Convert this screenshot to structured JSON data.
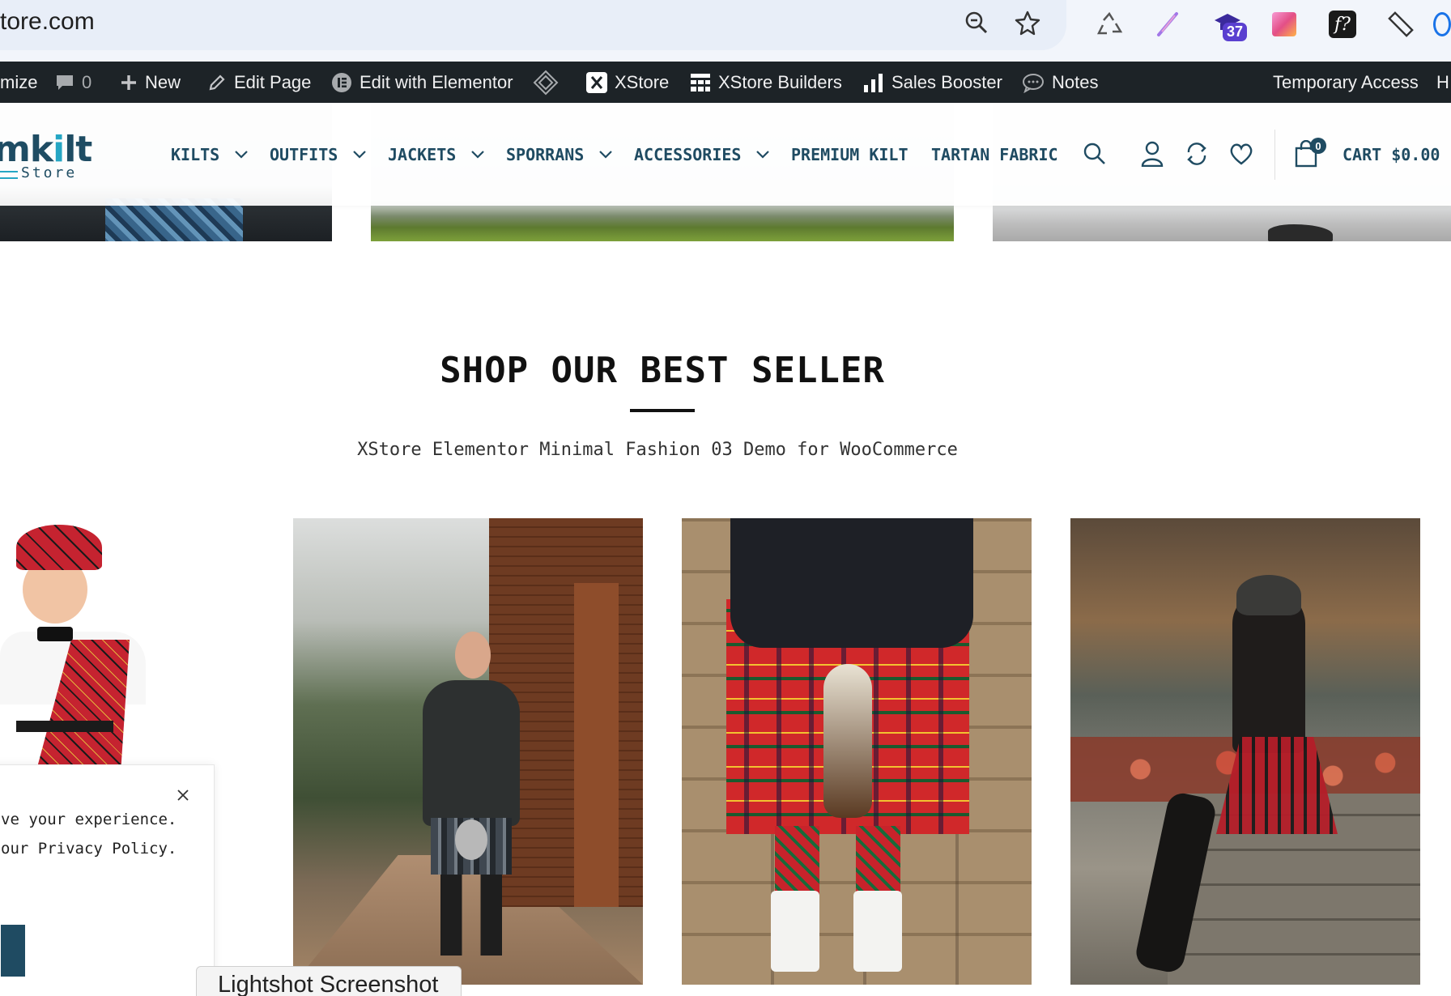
{
  "browser": {
    "url": "tore.com",
    "extension_badge": "37",
    "icons": [
      "zoom-icon",
      "star-icon",
      "recycle-icon",
      "feather-icon",
      "graduation-cap-icon",
      "gradient-square-icon",
      "font-question-icon",
      "ruler-icon"
    ]
  },
  "admin_bar": {
    "customize": "mize",
    "comments_count": "0",
    "new": "New",
    "edit_page": "Edit Page",
    "edit_elementor": "Edit with Elementor",
    "xstore": "XStore",
    "xstore_builders": "XStore Builders",
    "sales_booster": "Sales Booster",
    "notes": "Notes",
    "temporary_access": "Temporary Access",
    "howdy": "H"
  },
  "site": {
    "logo_main_dark_prefix": "m",
    "logo_main_dark_1": "k",
    "logo_main_teal": "i",
    "logo_main_dark_2": "lt",
    "logo_sub": "Store",
    "nav": {
      "kilts": "KILTS",
      "outfits": "OUTFITS",
      "jackets": "JACKETS",
      "sporrans": "SPORRANS",
      "accessories": "ACCESSORIES",
      "premium_kilt": "PREMIUM KILT",
      "tartan_fabric": "TARTAN FABRIC"
    },
    "cart_count": "0",
    "cart_label": "CART $0.00"
  },
  "section": {
    "title": "SHOP OUR BEST SELLER",
    "subtitle": "XStore Elementor Minimal Fashion 03 Demo for WooCommerce"
  },
  "cookie": {
    "line1": "ve your experience.",
    "line2": " our Privacy Policy."
  },
  "lightshot": {
    "label": "Lightshot Screenshot"
  },
  "colors": {
    "brand": "#1f4b62",
    "brand_accent": "#25a6c4",
    "admin_bar": "#1d2327"
  }
}
